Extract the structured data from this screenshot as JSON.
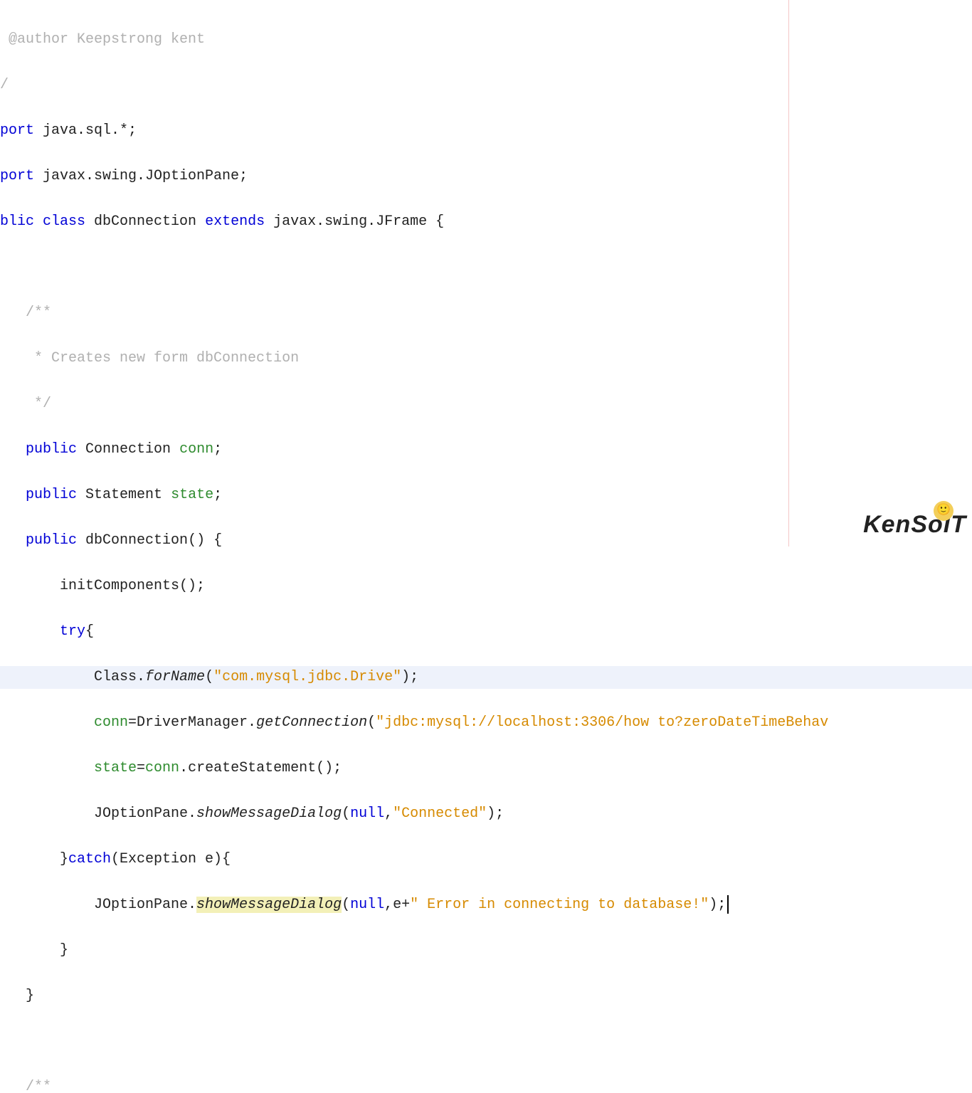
{
  "code": {
    "l1a": " @author Keepstrong kent",
    "l2a": "/",
    "l3a": "port ",
    "l3b": "java.sql.*;",
    "l4a": "port ",
    "l4b": "javax.swing.JOptionPane;",
    "l5a": "blic class ",
    "l5b": "dbConnection ",
    "l5c": "extends ",
    "l5d": "javax.swing.JFrame {",
    "l7a": "   /**",
    "l8a": "    * Creates new form dbConnection",
    "l9a": "    */",
    "l10a": "   public ",
    "l10b": "Connection ",
    "l10c": "conn",
    "l10d": ";",
    "l11a": "   public ",
    "l11b": "Statement ",
    "l11c": "state",
    "l11d": ";",
    "l12a": "   public ",
    "l12b": "dbConnection",
    "l12c": "() {",
    "l13a": "       initComponents();",
    "l14a": "       try",
    "l14b": "{",
    "l15a": "           Class.",
    "l15b": "forName",
    "l15c": "(",
    "l15d": "\"com.mysql.jdbc.Drive\"",
    "l15e": ");",
    "l16a": "           conn",
    "l16b": "=DriverManager.",
    "l16c": "getConnection",
    "l16d": "(",
    "l16e": "\"jdbc:mysql://localhost:3306/how to?zeroDateTimeBehav",
    "l17a": "           state",
    "l17b": "=",
    "l17c": "conn",
    "l17d": ".createStatement();",
    "l18a": "           JOptionPane.",
    "l18b": "showMessageDialog",
    "l18c": "(",
    "l18d": "null",
    "l18e": ",",
    "l18f": "\"Connected\"",
    "l18g": ");",
    "l19a": "       }",
    "l19b": "catch",
    "l19c": "(Exception e){",
    "l20a": "           JOptionPane.",
    "l20b": "showMessageDialog",
    "l20c": "(",
    "l20d": "null",
    "l20e": ",e+",
    "l20f": "\" Error in connecting to database!\"",
    "l20g": ");",
    "l21a": "       }",
    "l22a": "   }",
    "l24a": "   /**"
  },
  "logo": "KenSoIT",
  "emoji": "🙂"
}
